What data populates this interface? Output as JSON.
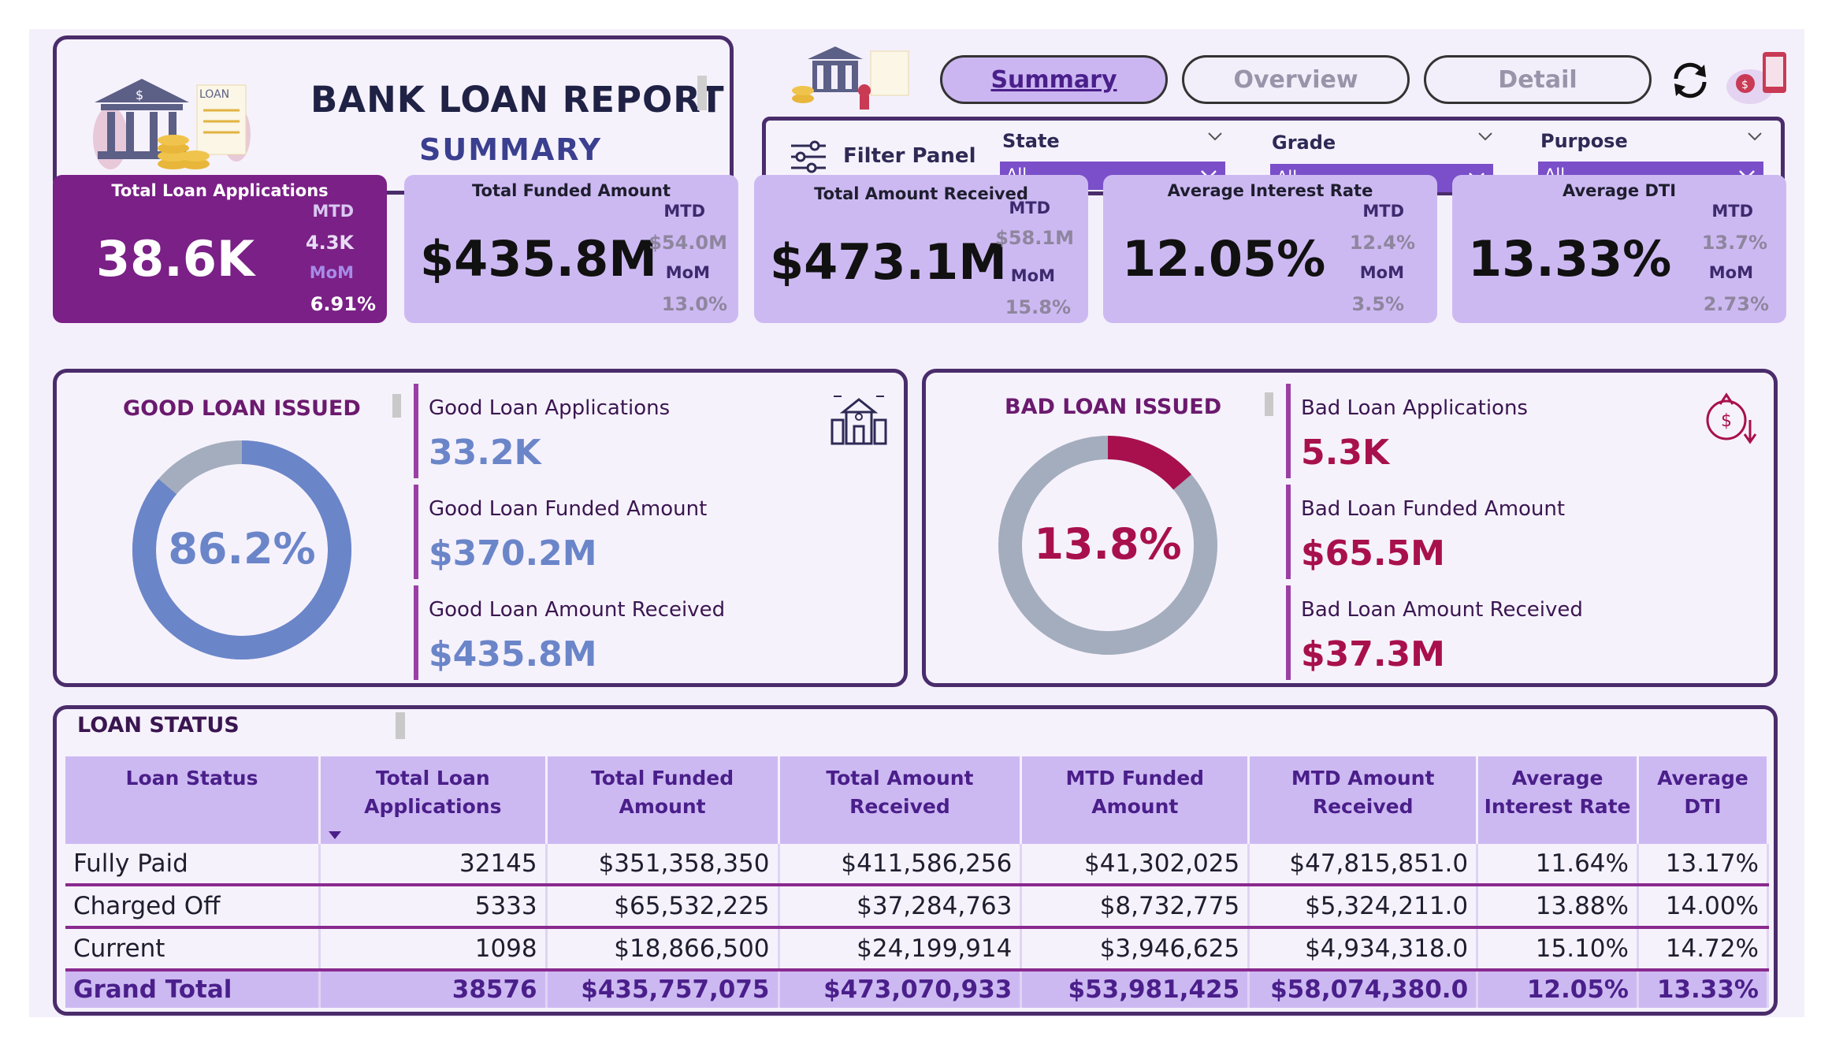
{
  "header": {
    "title": "BANK LOAN REPORT",
    "subtitle": "SUMMARY",
    "logo_text": "LOAN"
  },
  "nav": {
    "tabs": [
      "Summary",
      "Overview",
      "Detail"
    ],
    "active": "Summary"
  },
  "filter": {
    "label": "Filter Panel",
    "slicers": [
      {
        "title": "State",
        "value": "All"
      },
      {
        "title": "Grade",
        "value": "All"
      },
      {
        "title": "Purpose",
        "value": "All"
      }
    ]
  },
  "kpis": [
    {
      "title": "Total Loan Applications",
      "value": "38.6K",
      "mtd_label": "MTD",
      "mtd": "4.3K",
      "mom_label": "MoM",
      "mom": "6.91%"
    },
    {
      "title": "Total Funded Amount",
      "value": "$435.8M",
      "mtd_label": "MTD",
      "mtd": "$54.0M",
      "mom_label": "MoM",
      "mom": "13.0%"
    },
    {
      "title": "Total Amount Received",
      "value": "$473.1M",
      "mtd_label": "MTD",
      "mtd": "$58.1M",
      "mom_label": "MoM",
      "mom": "15.8%"
    },
    {
      "title": "Average Interest Rate",
      "value": "12.05%",
      "mtd_label": "MTD",
      "mtd": "12.4%",
      "mom_label": "MoM",
      "mom": "3.5%"
    },
    {
      "title": "Average DTI",
      "value": "13.33%",
      "mtd_label": "MTD",
      "mtd": "13.7%",
      "mom_label": "MoM",
      "mom": "2.73%"
    }
  ],
  "good_loan": {
    "title": "GOOD LOAN ISSUED",
    "pct_label": "86.2%",
    "pct": 0.862,
    "color": "#6b85c9",
    "track": "#a3adbd",
    "metrics": [
      {
        "label": "Good Loan Applications",
        "value": "33.2K"
      },
      {
        "label": "Good Loan Funded Amount",
        "value": "$370.2M"
      },
      {
        "label": "Good Loan Amount Received",
        "value": "$435.8M"
      }
    ]
  },
  "bad_loan": {
    "title": "BAD LOAN ISSUED",
    "pct_label": "13.8%",
    "pct": 0.138,
    "color": "#a8104d",
    "track": "#a3adbd",
    "metrics": [
      {
        "label": "Bad Loan Applications",
        "value": "5.3K"
      },
      {
        "label": "Bad Loan Funded Amount",
        "value": "$65.5M"
      },
      {
        "label": "Bad Loan Amount Received",
        "value": "$37.3M"
      }
    ]
  },
  "table": {
    "title": "LOAN STATUS",
    "headers": [
      "Loan Status",
      "Total Loan Applications",
      "Total Funded Amount",
      "Total Amount Received",
      "MTD Funded Amount",
      "MTD Amount Received",
      "Average Interest Rate",
      "Average DTI"
    ],
    "rows": [
      [
        "Fully Paid",
        "32145",
        "$351,358,350",
        "$411,586,256",
        "$41,302,025",
        "$47,815,851.0",
        "11.64%",
        "13.17%"
      ],
      [
        "Charged Off",
        "5333",
        "$65,532,225",
        "$37,284,763",
        "$8,732,775",
        "$5,324,211.0",
        "13.88%",
        "14.00%"
      ],
      [
        "Current",
        "1098",
        "$18,866,500",
        "$24,199,914",
        "$3,946,625",
        "$4,934,318.0",
        "15.10%",
        "14.72%"
      ]
    ],
    "total": [
      "Grand Total",
      "38576",
      "$435,757,075",
      "$473,070,933",
      "$53,981,425",
      "$58,074,380.0",
      "12.05%",
      "13.33%"
    ]
  },
  "icons": [
    "bank-icon",
    "refresh-icon",
    "filter-sliders-icon",
    "house-city-icon",
    "bad-loan-icon",
    "sort-down-icon"
  ]
}
